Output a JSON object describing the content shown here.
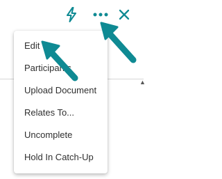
{
  "toolbar": {
    "accent_color": "#0f8a93",
    "buttons": [
      {
        "icon": "lightning-bolt-icon"
      },
      {
        "icon": "more-options-icon"
      },
      {
        "icon": "close-icon"
      }
    ]
  },
  "menu": {
    "items": [
      {
        "label": "Edit"
      },
      {
        "label": "Participants"
      },
      {
        "label": "Upload Document"
      },
      {
        "label": "Relates To..."
      },
      {
        "label": "Uncomplete"
      },
      {
        "label": "Hold In Catch-Up"
      }
    ]
  },
  "annotations": {
    "arrow_color": "#0f8a93",
    "arrows": [
      {
        "points_to": "more-options-icon"
      },
      {
        "points_to": "Edit"
      }
    ]
  }
}
